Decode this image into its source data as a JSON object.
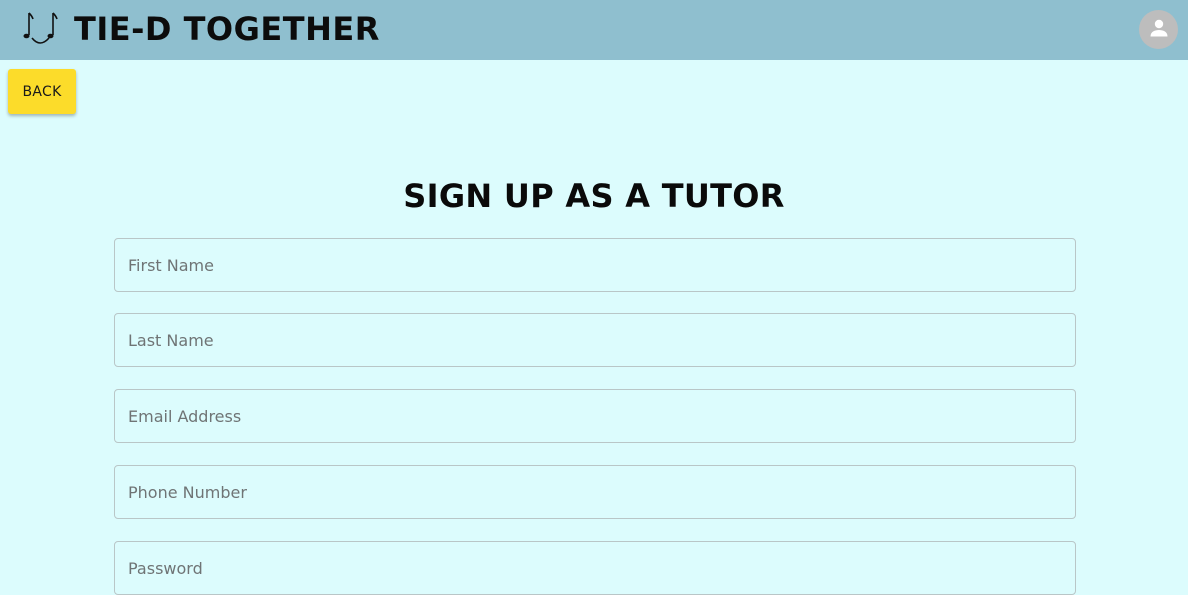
{
  "header": {
    "app_title": "TIE-D TOGETHER",
    "logo_icon": "music-notes-smile-icon",
    "avatar_icon": "person-icon"
  },
  "nav": {
    "back_label": "BACK"
  },
  "form": {
    "title": "SIGN UP AS A TUTOR",
    "fields": [
      {
        "placeholder": "First Name",
        "value": ""
      },
      {
        "placeholder": "Last Name",
        "value": ""
      },
      {
        "placeholder": "Email Address",
        "value": ""
      },
      {
        "placeholder": "Phone Number",
        "value": ""
      },
      {
        "placeholder": "Password",
        "value": ""
      }
    ]
  },
  "colors": {
    "appbar": "#8fbfcf",
    "background": "#dcfcfd",
    "back_button": "#fcdc2a",
    "avatar": "#bdbdbd"
  }
}
